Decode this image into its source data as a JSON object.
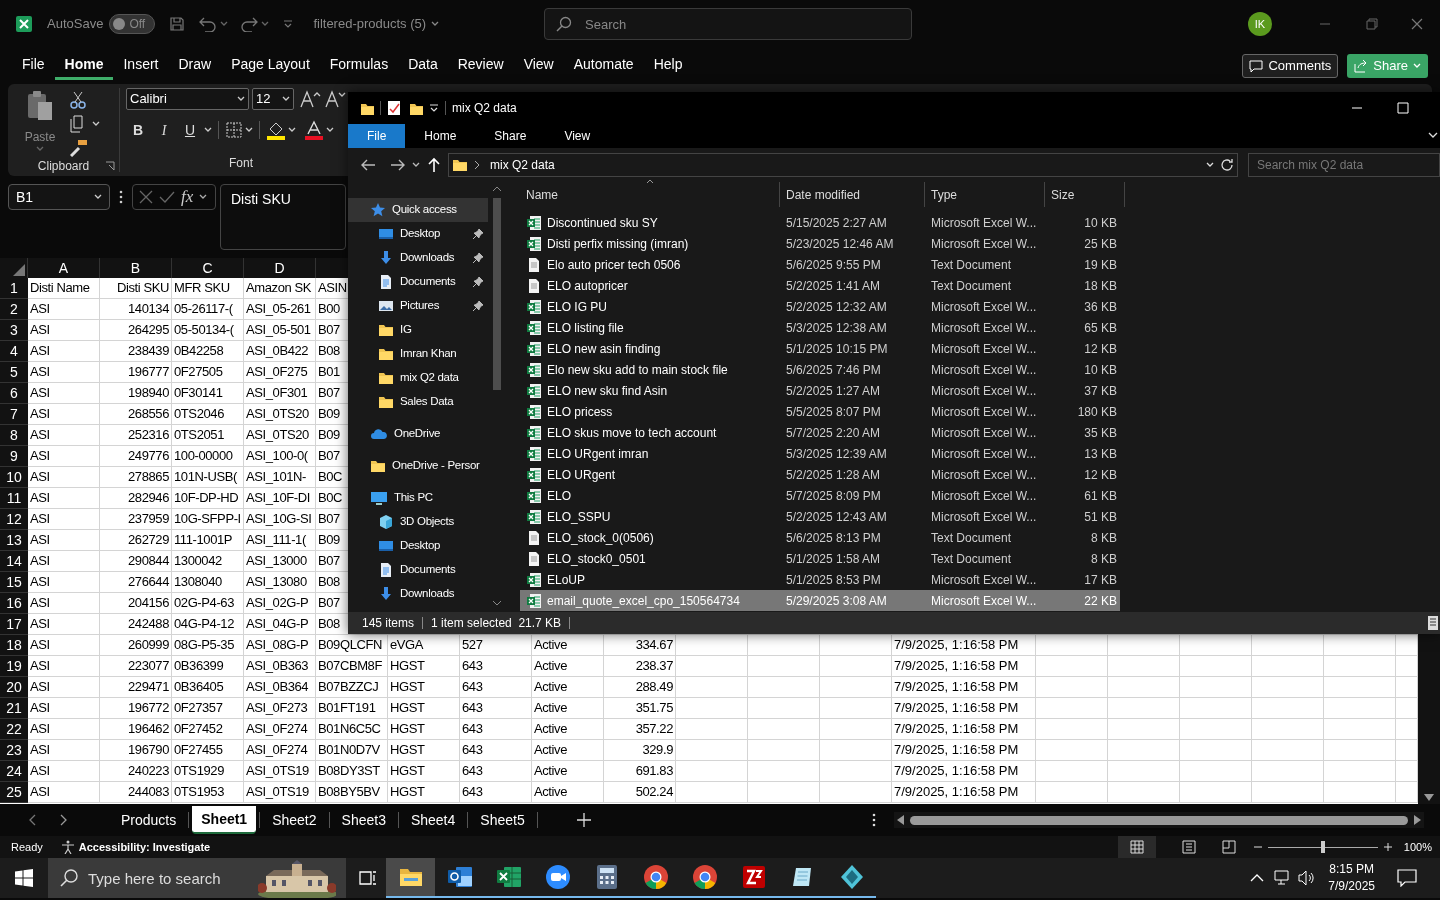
{
  "excel": {
    "autosave": {
      "label": "AutoSave",
      "on": false,
      "state_text": "Off"
    },
    "title": "filtered-products (5)",
    "search_placeholder": "Search",
    "avatar": "IK",
    "menu_tabs": [
      {
        "label": "File",
        "selected": false
      },
      {
        "label": "Home",
        "selected": true
      },
      {
        "label": "Insert",
        "selected": false
      },
      {
        "label": "Draw",
        "selected": false
      },
      {
        "label": "Page Layout",
        "selected": false
      },
      {
        "label": "Formulas",
        "selected": false
      },
      {
        "label": "Data",
        "selected": false
      },
      {
        "label": "Review",
        "selected": false
      },
      {
        "label": "View",
        "selected": false
      },
      {
        "label": "Automate",
        "selected": false
      },
      {
        "label": "Help",
        "selected": false
      }
    ],
    "comments_button": "Comments",
    "share_button": "Share",
    "ribbon": {
      "paste_label": "Paste",
      "font_name": "Calibri",
      "font_size": "12",
      "format_buttons": [
        "B",
        "I",
        "U"
      ],
      "groups": [
        "Clipboard",
        "Font"
      ]
    },
    "formula_bar": {
      "name_box": "B1",
      "function_symbol": "fx",
      "formula": "Disti SKU"
    },
    "grid": {
      "columns": [
        "A",
        "B",
        "C",
        "D"
      ],
      "rows": [
        {
          "number": "1",
          "cells": [
            "Disti Name",
            "Disti SKU",
            "MFR SKU",
            "Amazon SK",
            "ASIN"
          ]
        },
        {
          "number": "2",
          "cells": [
            "ASI",
            "140134",
            "05-26117-(",
            "ASI_05-261",
            "B00"
          ]
        },
        {
          "number": "3",
          "cells": [
            "ASI",
            "264295",
            "05-50134-(",
            "ASI_05-501",
            "B07"
          ]
        },
        {
          "number": "4",
          "cells": [
            "ASI",
            "238439",
            "0B42258",
            "ASI_0B422",
            "B08"
          ]
        },
        {
          "number": "5",
          "cells": [
            "ASI",
            "196777",
            "0F27505",
            "ASI_0F275",
            "B01"
          ]
        },
        {
          "number": "6",
          "cells": [
            "ASI",
            "198940",
            "0F30141",
            "ASI_0F301",
            "B07"
          ]
        },
        {
          "number": "7",
          "cells": [
            "ASI",
            "268556",
            "0TS2046",
            "ASI_0TS20",
            "B09"
          ]
        },
        {
          "number": "8",
          "cells": [
            "ASI",
            "252316",
            "0TS2051",
            "ASI_0TS20",
            "B09"
          ]
        },
        {
          "number": "9",
          "cells": [
            "ASI",
            "249776",
            "100-00000",
            "ASI_100-0(",
            "B07"
          ]
        },
        {
          "number": "10",
          "cells": [
            "ASI",
            "278865",
            "101N-USB(",
            "ASI_101N-",
            "B0C"
          ]
        },
        {
          "number": "11",
          "cells": [
            "ASI",
            "282946",
            "10F-DP-HD",
            "ASI_10F-DI",
            "B0C"
          ]
        },
        {
          "number": "12",
          "cells": [
            "ASI",
            "237959",
            "10G-SFPP-I",
            "ASI_10G-SI",
            "B07"
          ]
        },
        {
          "number": "13",
          "cells": [
            "ASI",
            "262729",
            "111-1001P",
            "ASI_111-1(",
            "B09"
          ]
        },
        {
          "number": "14",
          "cells": [
            "ASI",
            "290844",
            "1300042",
            "ASI_13000",
            "B07"
          ]
        },
        {
          "number": "15",
          "cells": [
            "ASI",
            "276644",
            "1308040",
            "ASI_13080",
            "B08"
          ]
        },
        {
          "number": "16",
          "cells": [
            "ASI",
            "204156",
            "02G-P4-63",
            "ASI_02G-P",
            "B07"
          ]
        },
        {
          "number": "17",
          "cells": [
            "ASI",
            "242488",
            "04G-P4-12",
            "ASI_04G-P",
            "B08"
          ]
        },
        {
          "number": "18",
          "cells": [
            "ASI",
            "260999",
            "08G-P5-35",
            "ASI_08G-P",
            "B09QLCFN",
            "eVGA",
            "527",
            "Active",
            "334.67"
          ],
          "timestamp": "7/9/2025, 1:16:58 PM"
        },
        {
          "number": "19",
          "cells": [
            "ASI",
            "223077",
            "0B36399",
            "ASI_0B363",
            "B07CBM8F",
            "HGST",
            "643",
            "Active",
            "238.37"
          ],
          "timestamp": "7/9/2025, 1:16:58 PM"
        },
        {
          "number": "20",
          "cells": [
            "ASI",
            "229471",
            "0B36405",
            "ASI_0B364",
            "B07BZZCJ",
            "HGST",
            "643",
            "Active",
            "288.49"
          ],
          "timestamp": "7/9/2025, 1:16:58 PM"
        },
        {
          "number": "21",
          "cells": [
            "ASI",
            "196772",
            "0F27357",
            "ASI_0F273",
            "B01FT191",
            "HGST",
            "643",
            "Active",
            "351.75"
          ],
          "timestamp": "7/9/2025, 1:16:58 PM"
        },
        {
          "number": "22",
          "cells": [
            "ASI",
            "196462",
            "0F27452",
            "ASI_0F274",
            "B01N6C5C",
            "HGST",
            "643",
            "Active",
            "357.22"
          ],
          "timestamp": "7/9/2025, 1:16:58 PM"
        },
        {
          "number": "23",
          "cells": [
            "ASI",
            "196790",
            "0F27455",
            "ASI_0F274",
            "B01N0D7V",
            "HGST",
            "643",
            "Active",
            "329.9"
          ],
          "timestamp": "7/9/2025, 1:16:58 PM"
        },
        {
          "number": "24",
          "cells": [
            "ASI",
            "240223",
            "0TS1929",
            "ASI_0TS19",
            "B08DY3ST",
            "HGST",
            "643",
            "Active",
            "691.83"
          ],
          "timestamp": "7/9/2025, 1:16:58 PM"
        },
        {
          "number": "25",
          "cells": [
            "ASI",
            "244083",
            "0TS1953",
            "ASI_0TS19",
            "B08BY5BV",
            "HGST",
            "643",
            "Active",
            "502.24"
          ],
          "timestamp": "7/9/2025, 1:16:58 PM"
        }
      ]
    },
    "sheet_tabs": [
      {
        "label": "Products",
        "selected": false
      },
      {
        "label": "Sheet1",
        "selected": true
      },
      {
        "label": "Sheet2",
        "selected": false
      },
      {
        "label": "Sheet3",
        "selected": false
      },
      {
        "label": "Sheet4",
        "selected": false
      },
      {
        "label": "Sheet5",
        "selected": false
      }
    ],
    "status": {
      "ready": "Ready",
      "accessibility": "Accessibility: Investigate",
      "zoom_slider": {
        "level": 0.5
      },
      "zoom": "100%"
    }
  },
  "explorer": {
    "title": "mix Q2 data",
    "tabs": [
      {
        "label": "File",
        "selected": true
      },
      {
        "label": "Home",
        "selected": false
      },
      {
        "label": "Share",
        "selected": false
      },
      {
        "label": "View",
        "selected": false
      }
    ],
    "address": "mix Q2 data",
    "search_placeholder": "Search mix Q2 data",
    "nav": [
      {
        "kind": "star",
        "label": "Quick access",
        "selected": true,
        "pinned": false,
        "children": [
          {
            "kind": "desktop",
            "label": "Desktop",
            "selected": false,
            "pinned": true
          },
          {
            "kind": "download",
            "label": "Downloads",
            "selected": false,
            "pinned": true
          },
          {
            "kind": "documents",
            "label": "Documents",
            "selected": false,
            "pinned": true
          },
          {
            "kind": "pictures",
            "label": "Pictures",
            "selected": false,
            "pinned": true
          },
          {
            "kind": "folder",
            "label": "IG",
            "selected": false,
            "pinned": false
          },
          {
            "kind": "folder",
            "label": "Imran Khan",
            "selected": false,
            "pinned": false
          },
          {
            "kind": "folder",
            "label": "mix Q2 data",
            "selected": false,
            "pinned": false
          },
          {
            "kind": "folder",
            "label": "Sales Data",
            "selected": false,
            "pinned": false
          }
        ]
      },
      {
        "kind": "cloud",
        "label": "OneDrive",
        "selected": false,
        "pinned": false
      },
      {
        "kind": "folder",
        "label": "OneDrive - Persor",
        "selected": false,
        "pinned": false
      },
      {
        "kind": "computer",
        "label": "This PC",
        "selected": false,
        "pinned": false,
        "children": [
          {
            "kind": "cube",
            "label": "3D Objects",
            "selected": false,
            "pinned": false
          },
          {
            "kind": "desktop",
            "label": "Desktop",
            "selected": false,
            "pinned": false
          },
          {
            "kind": "documents",
            "label": "Documents",
            "selected": false,
            "pinned": false
          },
          {
            "kind": "download",
            "label": "Downloads",
            "selected": false,
            "pinned": false
          }
        ]
      }
    ],
    "columns": [
      "Name",
      "Date modified",
      "Type",
      "Size"
    ],
    "files": [
      {
        "kind": "excel",
        "name": "Discontinued sku SY",
        "date": "5/15/2025 2:27 AM",
        "type": "Microsoft Excel W...",
        "size": "10 KB",
        "selected": false
      },
      {
        "kind": "excel",
        "name": "Disti perfix missing (imran)",
        "date": "5/23/2025 12:46 AM",
        "type": "Microsoft Excel W...",
        "size": "25 KB",
        "selected": false
      },
      {
        "kind": "text",
        "name": "Elo auto pricer tech 0506",
        "date": "5/6/2025 9:55 PM",
        "type": "Text Document",
        "size": "19 KB",
        "selected": false
      },
      {
        "kind": "text",
        "name": "ELO autopricer",
        "date": "5/2/2025 1:41 AM",
        "type": "Text Document",
        "size": "18 KB",
        "selected": false
      },
      {
        "kind": "excel",
        "name": "ELO IG PU",
        "date": "5/2/2025 12:32 AM",
        "type": "Microsoft Excel W...",
        "size": "36 KB",
        "selected": false
      },
      {
        "kind": "excel",
        "name": "ELO listing file",
        "date": "5/3/2025 12:38 AM",
        "type": "Microsoft Excel W...",
        "size": "65 KB",
        "selected": false
      },
      {
        "kind": "excel",
        "name": "ELO new asin finding",
        "date": "5/1/2025 10:15 PM",
        "type": "Microsoft Excel W...",
        "size": "12 KB",
        "selected": false
      },
      {
        "kind": "excel",
        "name": "Elo new sku add to main stock file",
        "date": "5/6/2025 7:46 PM",
        "type": "Microsoft Excel W...",
        "size": "10 KB",
        "selected": false
      },
      {
        "kind": "excel",
        "name": "ELO new sku find Asin",
        "date": "5/2/2025 1:27 AM",
        "type": "Microsoft Excel W...",
        "size": "37 KB",
        "selected": false
      },
      {
        "kind": "excel",
        "name": "ELO pricess",
        "date": "5/5/2025 8:07 PM",
        "type": "Microsoft Excel W...",
        "size": "180 KB",
        "selected": false
      },
      {
        "kind": "excel",
        "name": "ELO skus move to tech account",
        "date": "5/7/2025 2:20 AM",
        "type": "Microsoft Excel W...",
        "size": "35 KB",
        "selected": false
      },
      {
        "kind": "excel",
        "name": "ELO URgent imran",
        "date": "5/3/2025 12:39 AM",
        "type": "Microsoft Excel W...",
        "size": "13 KB",
        "selected": false
      },
      {
        "kind": "excel",
        "name": "ELO URgent",
        "date": "5/2/2025 1:28 AM",
        "type": "Microsoft Excel W...",
        "size": "12 KB",
        "selected": false
      },
      {
        "kind": "excel",
        "name": "ELO",
        "date": "5/7/2025 8:09 PM",
        "type": "Microsoft Excel W...",
        "size": "61 KB",
        "selected": false
      },
      {
        "kind": "excel",
        "name": "ELO_SSPU",
        "date": "5/2/2025 12:43 AM",
        "type": "Microsoft Excel W...",
        "size": "51 KB",
        "selected": false
      },
      {
        "kind": "text",
        "name": "ELO_stock_0(0506)",
        "date": "5/6/2025 8:13 PM",
        "type": "Text Document",
        "size": "8 KB",
        "selected": false
      },
      {
        "kind": "text",
        "name": "ELO_stock0_0501",
        "date": "5/1/2025 1:58 AM",
        "type": "Text Document",
        "size": "8 KB",
        "selected": false
      },
      {
        "kind": "excel",
        "name": "ELoUP",
        "date": "5/1/2025 8:53 PM",
        "type": "Microsoft Excel W...",
        "size": "17 KB",
        "selected": false
      },
      {
        "kind": "excel",
        "name": "email_quote_excel_cpo_150564734",
        "date": "5/29/2025 3:08 AM",
        "type": "Microsoft Excel W...",
        "size": "22 KB",
        "selected": true
      }
    ],
    "item_count": "145 items",
    "selection_info": "1 item selected  21.7 KB"
  },
  "taskbar": {
    "search_placeholder": "Type here to search",
    "apps": [
      {
        "kind": "folder",
        "active": true
      },
      {
        "kind": "mail",
        "active": false
      },
      {
        "kind": "spreadsheet",
        "active": false
      },
      {
        "kind": "video",
        "active": false
      },
      {
        "kind": "calculator",
        "active": false
      },
      {
        "kind": "browser",
        "active": false
      },
      {
        "kind": "browser",
        "active": false
      },
      {
        "kind": "ftp",
        "active": false
      },
      {
        "kind": "notes",
        "active": false
      },
      {
        "kind": "diamond",
        "active": false
      }
    ],
    "time": "8:15 PM",
    "date": "7/9/2025"
  }
}
